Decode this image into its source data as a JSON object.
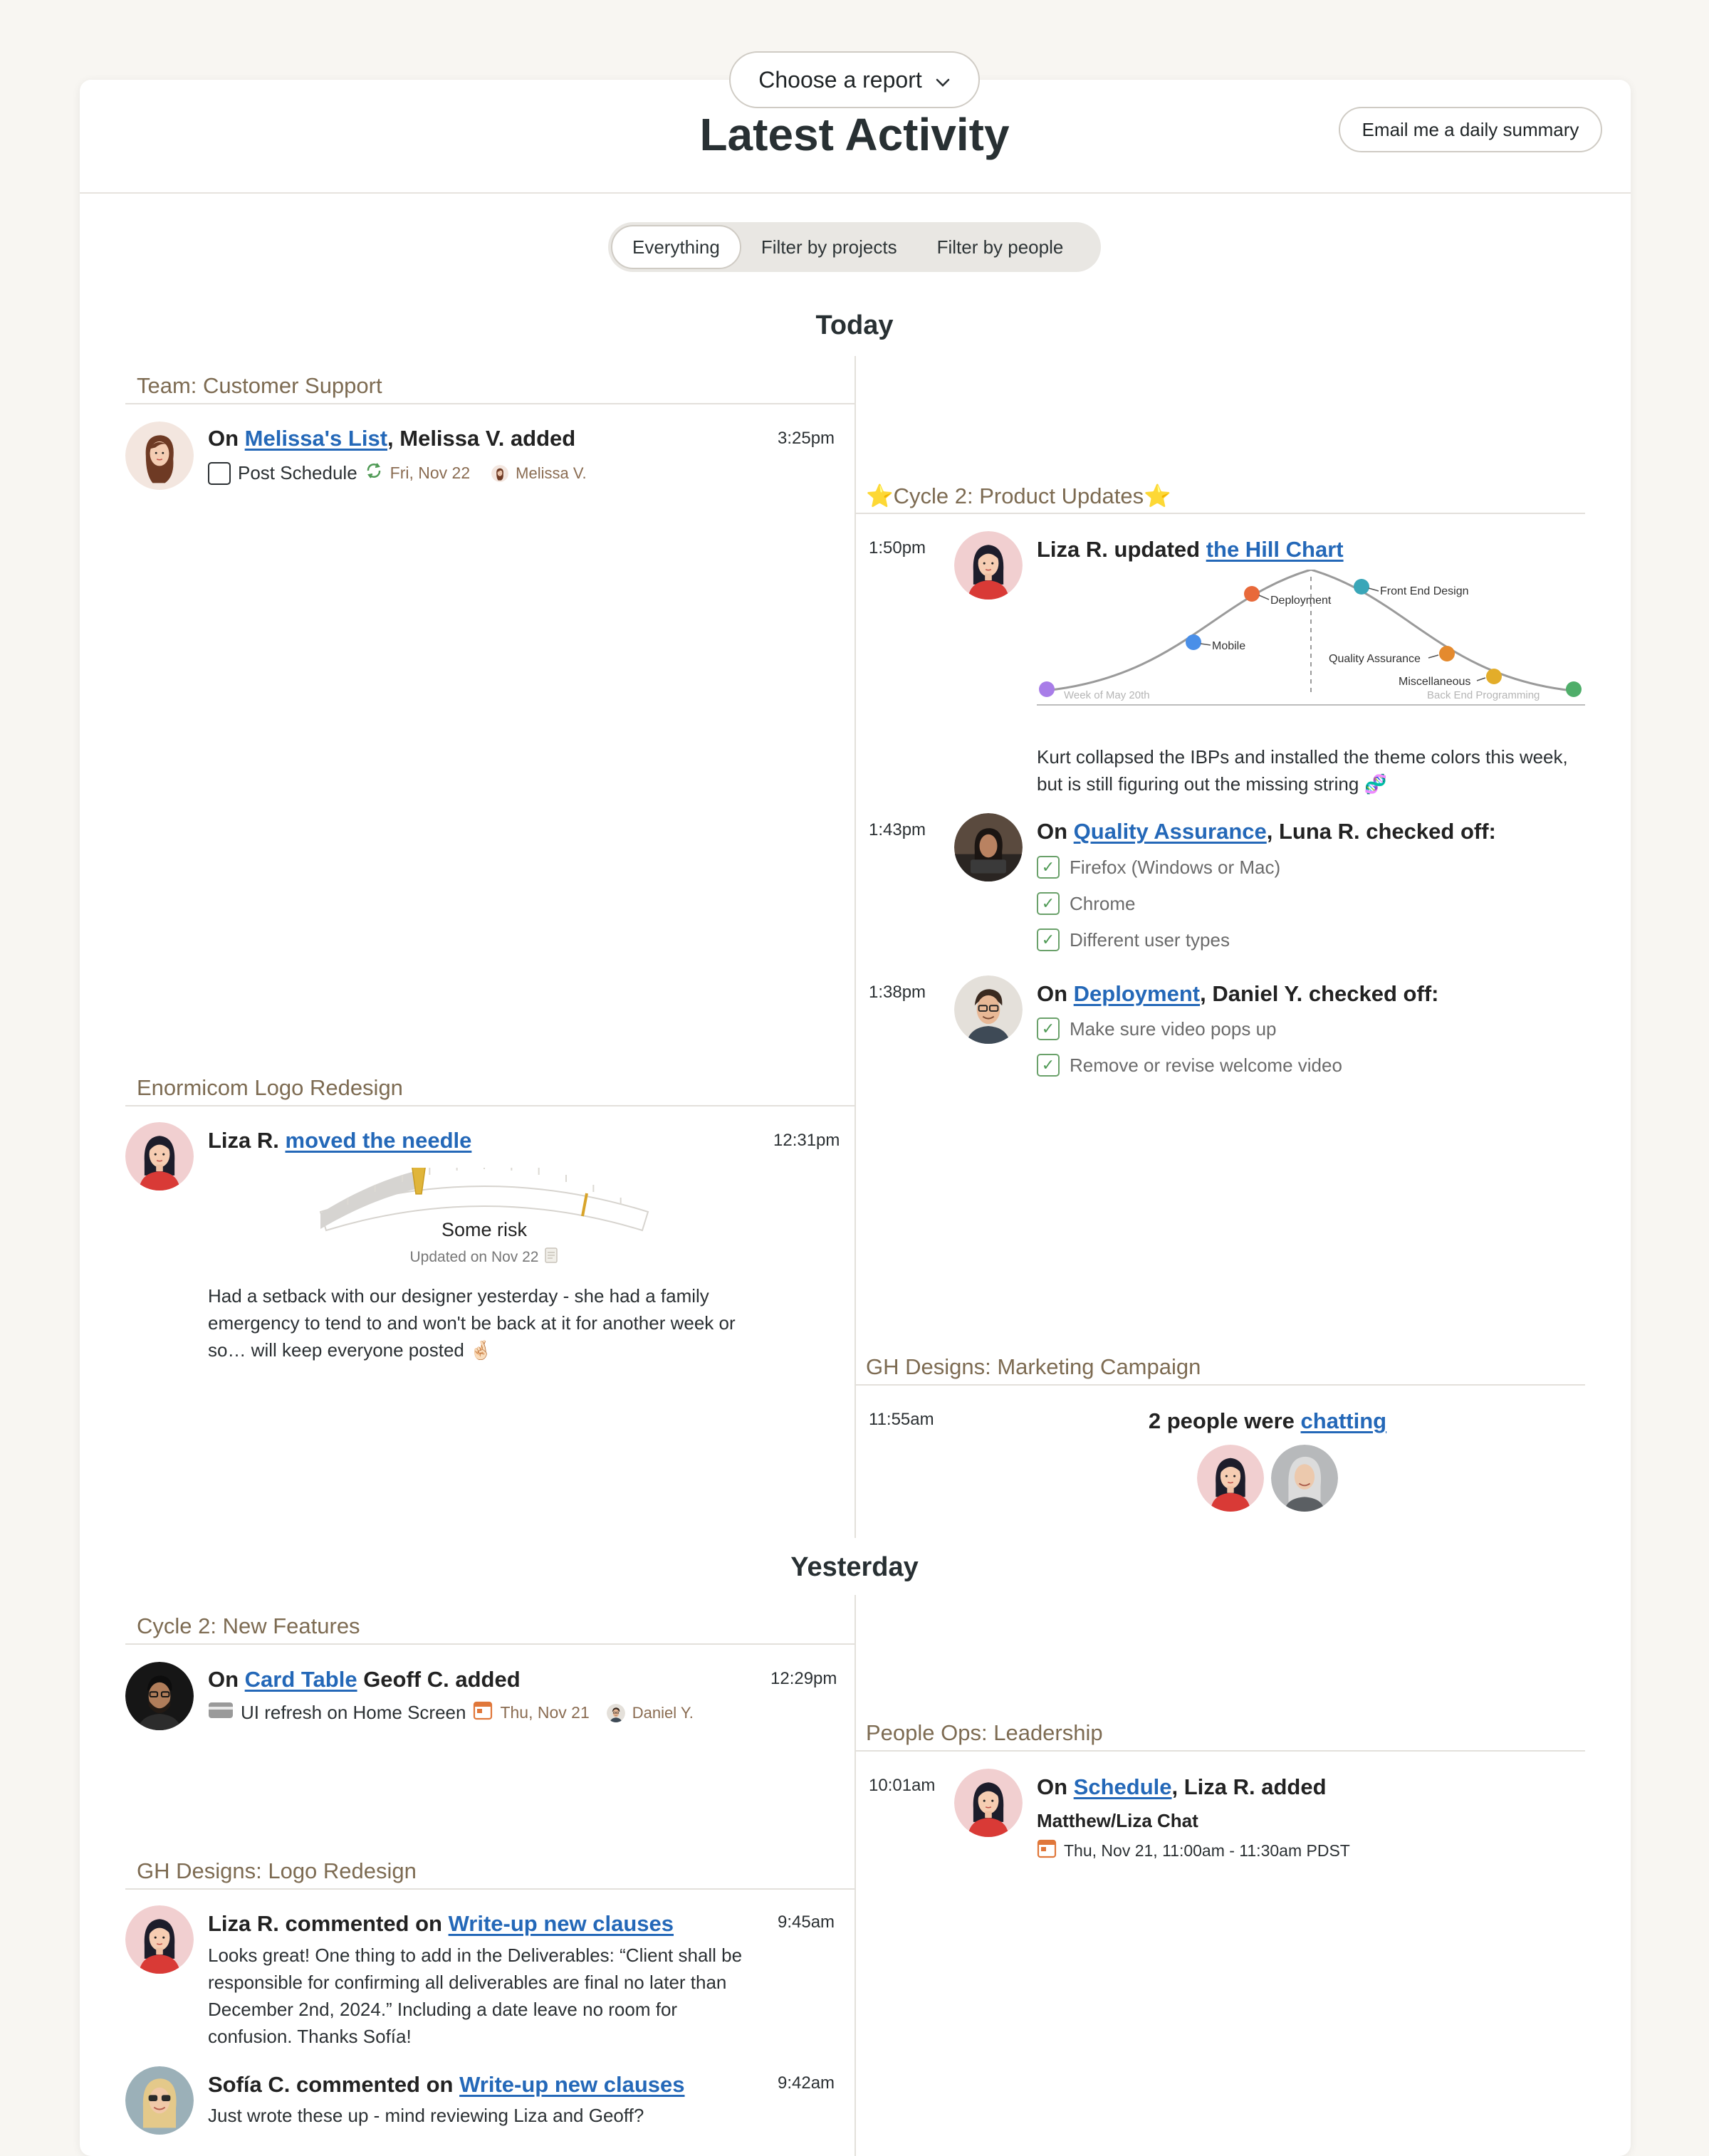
{
  "header": {
    "report_button": "Choose a report",
    "title": "Latest Activity",
    "email_button": "Email me a daily summary"
  },
  "filters": [
    "Everything",
    "Filter by projects",
    "Filter by people"
  ],
  "days": {
    "today": "Today",
    "yesterday": "Yesterday"
  },
  "sections": {
    "customer_support": {
      "title": "Team: Customer Support",
      "time": "3:25pm",
      "prefix": "On ",
      "link": "Melissa's List",
      "suffix": ", Melissa V. added",
      "item": "Post Schedule",
      "date": "Fri, Nov 22",
      "person": "Melissa V."
    },
    "logo_redesign": {
      "title": "Enormicom Logo Redesign",
      "time": "12:31pm",
      "prefix": "Liza R. ",
      "link": "moved the needle",
      "gauge_label": "Some risk",
      "gauge_updated": "Updated on Nov 22",
      "gauge_level": 0.3,
      "note": "Had a setback with our designer yesterday - she had a family emergency to tend to and won't be back at it for another week or so… will keep everyone posted 🤞🏻"
    },
    "product_updates": {
      "title": "⭐Cycle 2: Product Updates⭐",
      "hill": {
        "time": "1:50pm",
        "prefix": "Liza R. updated ",
        "link": "the Hill Chart",
        "labels": {
          "deployment": "Deployment",
          "front_end": "Front End Design",
          "mobile": "Mobile",
          "qa": "Quality Assurance",
          "misc": "Miscellaneous",
          "week": "Week of May 20th",
          "back_end": "Back End Programming"
        },
        "colors": {
          "deployment": "#e8693a",
          "front_end": "#3aa6b8",
          "mobile": "#4a8fe8",
          "qa": "#e48a2e",
          "misc": "#e3ad2a",
          "week": "#a87de8",
          "back_end": "#4fae6a"
        },
        "note": "Kurt collapsed the IBPs and installed the theme colors this week, but is still figuring out the missing string 🧬"
      },
      "qa_check": {
        "time": "1:43pm",
        "prefix": "On ",
        "link": "Quality Assurance",
        "suffix": ", Luna R. checked off:",
        "items": [
          "Firefox (Windows or Mac)",
          "Chrome",
          "Different user types"
        ]
      },
      "deploy_check": {
        "time": "1:38pm",
        "prefix": "On ",
        "link": "Deployment",
        "suffix": ", Daniel Y. checked off:",
        "items": [
          "Make sure video pops up",
          "Remove or revise welcome video"
        ]
      }
    },
    "marketing": {
      "title": "GH Designs: Marketing Campaign",
      "time": "11:55am",
      "prefix": "2 people were ",
      "link": "chatting"
    },
    "new_features": {
      "title": "Cycle 2: New Features",
      "time": "12:29pm",
      "prefix": "On ",
      "link": "Card Table",
      "suffix": " Geoff C. added",
      "item": "UI refresh on Home Screen",
      "date": "Thu, Nov 21",
      "person": "Daniel Y."
    },
    "people_ops": {
      "title": "People Ops: Leadership",
      "time": "10:01am",
      "prefix": "On ",
      "link": "Schedule",
      "suffix": ", Liza R. added",
      "event": "Matthew/Liza Chat",
      "when": "Thu, Nov 21, 11:00am - 11:30am PDST"
    },
    "gh_logo": {
      "title": "GH Designs: Logo Redesign",
      "comment1": {
        "time": "9:45am",
        "prefix": "Liza R. commented on ",
        "link": "Write-up new clauses",
        "text": "Looks great! One thing to add in the Deliverables: “Client shall be responsible for confirming all deliverables are final no later than December 2nd, 2024.” Including a date leave no room for confusion. Thanks Sofía!"
      },
      "comment2": {
        "time": "9:42am",
        "prefix": "Sofía C. commented on ",
        "link": "Write-up new clauses",
        "text": "Just wrote these up - mind reviewing Liza and Geoff?"
      }
    }
  },
  "colors": {
    "link": "#2468b8",
    "section_title": "#7d6b52",
    "check": "#4f9a55"
  }
}
